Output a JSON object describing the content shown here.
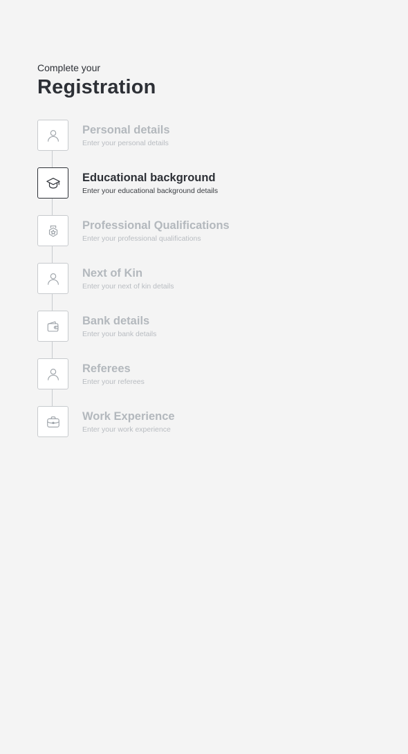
{
  "header": {
    "kicker": "Complete your",
    "title": "Registration"
  },
  "colors": {
    "background": "#f4f4f4",
    "active_text": "#2d3036",
    "inactive_text": "#b3b8bd",
    "border": "#c7cacd"
  },
  "steps": [
    {
      "label": "Personal details",
      "description": "Enter your personal details",
      "icon": "user-icon",
      "active": false
    },
    {
      "label": "Educational background",
      "description": "Enter your educational background details",
      "icon": "graduation-cap-icon",
      "active": true
    },
    {
      "label": "Professional Qualifications",
      "description": "Enter your professional qualifications",
      "icon": "badge-icon",
      "active": false
    },
    {
      "label": "Next of Kin",
      "description": "Enter your next of kin details",
      "icon": "user-icon",
      "active": false
    },
    {
      "label": "Bank details",
      "description": "Enter your bank details",
      "icon": "wallet-icon",
      "active": false
    },
    {
      "label": "Referees",
      "description": "Enter your referees",
      "icon": "user-icon",
      "active": false
    },
    {
      "label": "Work Experience",
      "description": "Enter your work experience",
      "icon": "briefcase-icon",
      "active": false
    }
  ]
}
